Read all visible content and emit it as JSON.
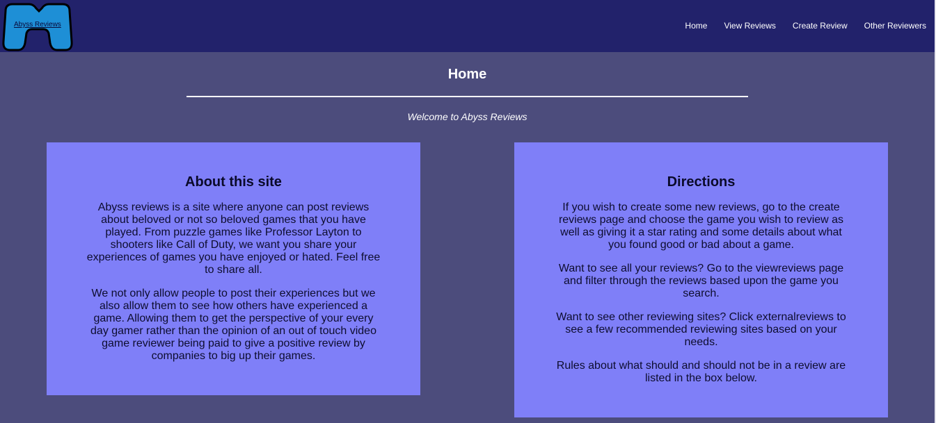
{
  "header": {
    "logo_text": "Abyss Reviews",
    "nav": [
      "Home",
      "View Reviews",
      "Create Review",
      "Other Reviewers"
    ]
  },
  "page": {
    "title": "Home",
    "welcome": "Welcome to Abyss Reviews"
  },
  "about": {
    "heading": "About this site",
    "paragraphs": [
      "Abyss reviews is a site where anyone can post reviews about beloved or not so beloved games that you have played. From puzzle games like Professor Layton to shooters like Call of Duty, we want you share your experiences of games you have enjoyed or hated. Feel free to share all.",
      "We not only allow people to post their experiences but we also allow them to see how others have experienced a game. Allowing them to get the perspective of your every day gamer rather than the opinion of an out of touch video game reviewer being paid to give a positive review by companies to big up their games."
    ]
  },
  "directions": {
    "heading": "Directions",
    "paragraphs": [
      "If you wish to create some new reviews, go to the create reviews page and choose the game you wish to review as well as giving it a star rating and some details about what you found good or bad about a game.",
      "Want to see all your reviews? Go to the viewreviews page and filter through the reviews based upon the game you search.",
      "Want to see other reviewing sites? Click externalreviews to see a few recommended reviewing sites based on your needs.",
      "Rules about what should and should not be in a review are listed in the box below."
    ]
  },
  "colors": {
    "header_bg": "#22226b",
    "page_bg": "#4c4c7c",
    "card_bg": "#7f7ff8",
    "logo_fill": "#1e8fd6"
  }
}
